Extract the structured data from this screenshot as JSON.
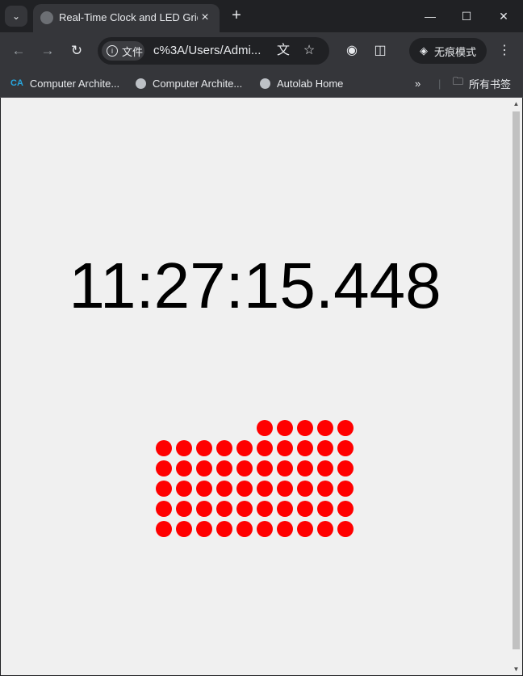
{
  "browser": {
    "tab": {
      "title": "Real-Time Clock and LED Grid"
    },
    "address": {
      "chip_label": "文件",
      "url": "c%3A/Users/Admi..."
    },
    "incognito_label": "无痕模式",
    "bookmarks": [
      {
        "label": "Computer Archite...",
        "icon": "ca-logo-icon"
      },
      {
        "label": "Computer Archite...",
        "icon": "globe-icon"
      },
      {
        "label": "Autolab Home",
        "icon": "globe-icon"
      }
    ],
    "all_bookmarks_label": "所有书签"
  },
  "page": {
    "clock_text": "11:27:15.448",
    "led_color": "#ff0000",
    "background": "#f0f0f0",
    "led_grid": {
      "columns": 10,
      "rows": 6,
      "lit": [
        [
          0,
          0,
          0,
          0,
          0,
          1,
          1,
          1,
          1,
          1
        ],
        [
          1,
          1,
          1,
          1,
          1,
          1,
          1,
          1,
          1,
          1
        ],
        [
          1,
          1,
          1,
          1,
          1,
          1,
          1,
          1,
          1,
          1
        ],
        [
          1,
          1,
          1,
          1,
          1,
          1,
          1,
          1,
          1,
          1
        ],
        [
          1,
          1,
          1,
          1,
          1,
          1,
          1,
          1,
          1,
          1
        ],
        [
          1,
          1,
          1,
          1,
          1,
          1,
          1,
          1,
          1,
          1
        ]
      ]
    }
  }
}
